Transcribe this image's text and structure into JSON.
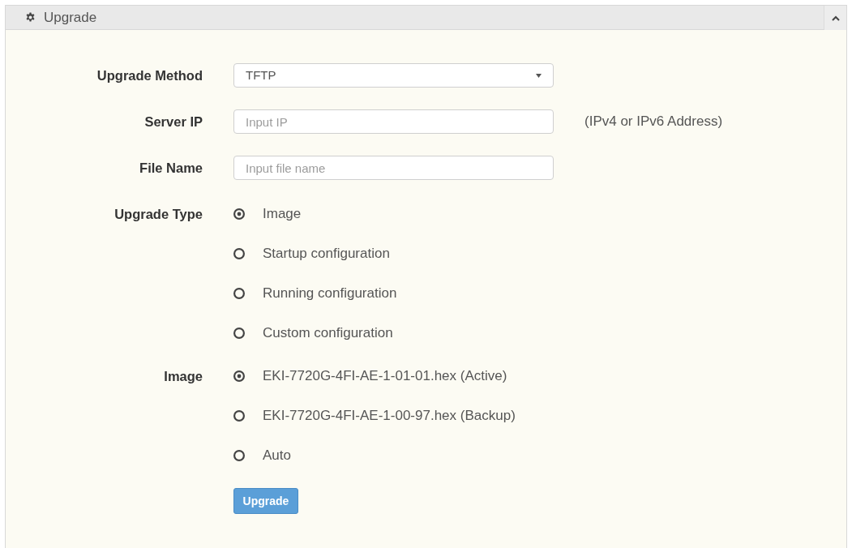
{
  "panel": {
    "title": "Upgrade",
    "expanded": true,
    "fields": [
      {
        "kind": "select",
        "label": "Upgrade Method",
        "value": "TFTP"
      },
      {
        "kind": "text",
        "label": "Server IP",
        "placeholder": "Input IP",
        "note": "(IPv4 or IPv6 Address)"
      },
      {
        "kind": "text",
        "label": "File Name",
        "placeholder": "Input file name"
      },
      {
        "kind": "radio",
        "label": "Upgrade Type",
        "options": [
          {
            "label": "Image",
            "selected": true
          },
          {
            "label": "Startup configuration",
            "selected": false
          },
          {
            "label": "Running configuration",
            "selected": false
          },
          {
            "label": "Custom configuration",
            "selected": false
          }
        ]
      },
      {
        "kind": "radio",
        "label": "Image",
        "options": [
          {
            "label": "EKI-7720G-4FI-AE-1-01-01.hex (Active)",
            "selected": true
          },
          {
            "label": "EKI-7720G-4FI-AE-1-00-97.hex (Backup)",
            "selected": false
          },
          {
            "label": "Auto",
            "selected": false
          }
        ]
      }
    ],
    "button": "Upgrade"
  }
}
